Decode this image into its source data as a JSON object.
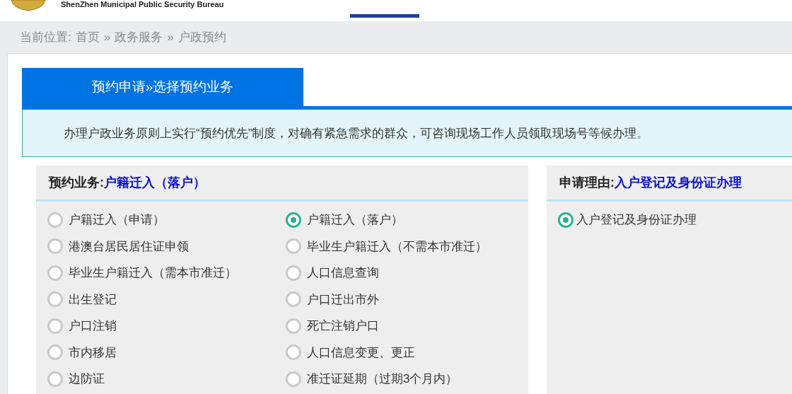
{
  "header": {
    "title": "ShenZhen Municipal Public Security Bureau"
  },
  "breadcrumb": {
    "label": "当前位置:",
    "items": [
      {
        "text": "首页"
      },
      {
        "text": "政务服务"
      },
      {
        "text": "户政预约"
      }
    ],
    "separator": "»"
  },
  "tab": {
    "title": "预约申请»选择预约业务"
  },
  "notice": "办理户政业务原则上实行“预约优先”制度，对确有紧急需求的群众，可咨询现场工作人员领取现场号等候办理。",
  "business_panel": {
    "label": "预约业务:",
    "value": "户籍迁入（落户）",
    "options": [
      {
        "text": "户籍迁入（申请）",
        "selected": false
      },
      {
        "text": "户籍迁入（落户）",
        "selected": true
      },
      {
        "text": "港澳台居民居住证申领",
        "selected": false
      },
      {
        "text": "毕业生户籍迁入（不需本市准迁）",
        "selected": false
      },
      {
        "text": "毕业生户籍迁入（需本市准迁）",
        "selected": false
      },
      {
        "text": "人口信息查询",
        "selected": false
      },
      {
        "text": "出生登记",
        "selected": false
      },
      {
        "text": "户口迁出市外",
        "selected": false
      },
      {
        "text": "户口注销",
        "selected": false
      },
      {
        "text": "死亡注销户口",
        "selected": false
      },
      {
        "text": "市内移居",
        "selected": false
      },
      {
        "text": "人口信息变更、更正",
        "selected": false
      },
      {
        "text": "边防证",
        "selected": false
      },
      {
        "text": "准迁证延期（过期3个月内）",
        "selected": false
      }
    ]
  },
  "reason_panel": {
    "label": "申请理由:",
    "value": "入户登记及身份证办理",
    "options": [
      {
        "text": "入户登记及身份证办理",
        "selected": true
      }
    ]
  }
}
